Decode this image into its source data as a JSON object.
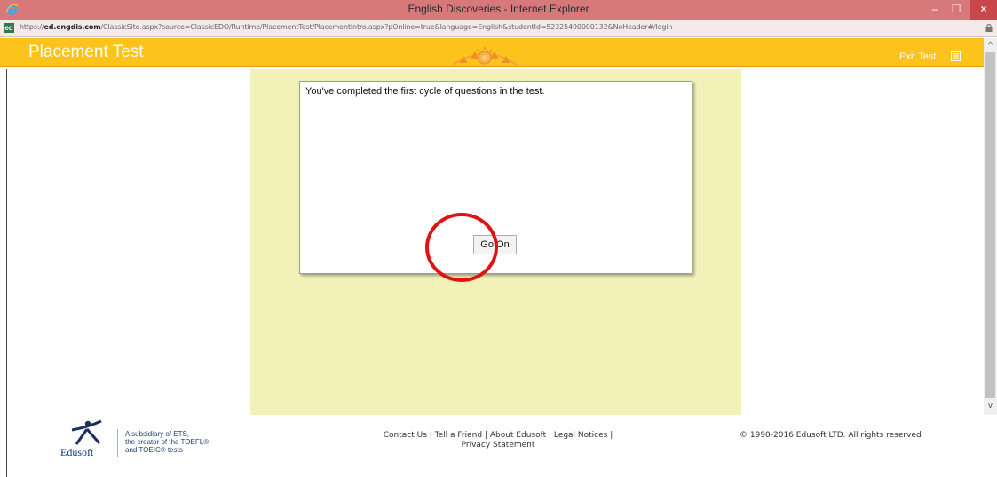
{
  "window": {
    "title": "English Discoveries - Internet Explorer",
    "minimize_glyph": "–",
    "maximize_glyph": "❐",
    "close_glyph": "×"
  },
  "address": {
    "site_icon_text": "ed",
    "url_prefix": "https://",
    "url_host": "ed.engdis.com",
    "url_path": "/ClassicSite.aspx?source=ClassicEDO/Runtime/PlacementTest/PlacementIntro.aspx?pOnline=true&language=English&studentId=52325490000132&NoHeader#/login"
  },
  "header": {
    "title": "Placement Test",
    "exit_label": "Exit Test",
    "exit_icon": "⊠"
  },
  "scrollbar": {
    "up_glyph": "^",
    "down_glyph": "v"
  },
  "dialog": {
    "message": "You've completed the first cycle of questions in the test.",
    "button_label": "Go On"
  },
  "footer": {
    "logo_text": "Edusoft",
    "ets_line1": "A subsidiary of ETS,",
    "ets_line2": "the creator of the TOEFL®",
    "ets_line3": "and TOEIC® tests",
    "links": [
      "Contact Us",
      "Tell a Friend",
      "About Edusoft",
      "Legal Notices",
      "Privacy Statement"
    ],
    "separator": " | ",
    "copyright": "© 1990-2016 Edusoft LTD. All rights reserved"
  },
  "colors": {
    "titlebar": "#d7787a",
    "header": "#fbc31b",
    "content_bg": "#f1f1b8",
    "highlight": "#e31212"
  }
}
